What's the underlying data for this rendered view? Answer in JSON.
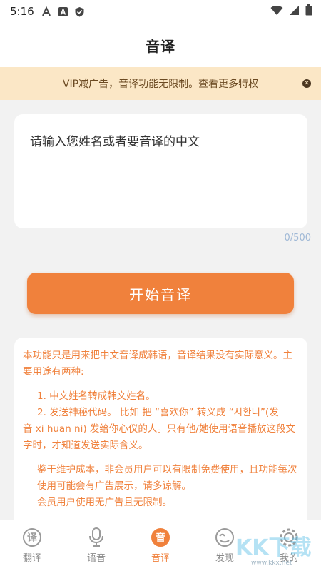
{
  "status_bar": {
    "time": "5:16",
    "left_icons": [
      "font-a-icon",
      "font-box-icon",
      "shield-check-icon"
    ],
    "right_icons": [
      "wifi-icon",
      "signal-icon",
      "battery-icon"
    ]
  },
  "header": {
    "title": "音译"
  },
  "vip_banner": {
    "text": "VIP减广告，音译功能无限制。查看更多特权",
    "close_icon": "close-icon"
  },
  "input": {
    "placeholder": "请输入您姓名或者要音译的中文",
    "value": "",
    "counter": "0/500"
  },
  "start_button": {
    "label": "开始音译"
  },
  "info": {
    "paragraph1": "本功能只是用来把中文音译成韩语，音译结果没有实际意义。主要用途有两种:",
    "item1": "1. 中文姓名转成韩文姓名。",
    "item2_line1": "2. 发送神秘代码。 比如 把 “喜欢你” 转义成 “시환니”(发",
    "item2_rest": "音 xi huan ni) 发给你心仪的人。只有他/她使用语音播放这段文字时，才知道发送实际含义。",
    "paragraph2": "鉴于维护成本，非会员用户可以有限制免费使用，且功能每次使用可能会有广告展示，请多谅解。",
    "paragraph3": "会员用户使用无广告且无限制。"
  },
  "bottom_nav": {
    "items": [
      {
        "label": "翻译",
        "glyph": "译",
        "icon": "translate-icon",
        "active": false
      },
      {
        "label": "语音",
        "glyph": "",
        "icon": "microphone-icon",
        "active": false
      },
      {
        "label": "音译",
        "glyph": "音",
        "icon": "transliterate-icon",
        "active": true
      },
      {
        "label": "发现",
        "glyph": "",
        "icon": "discover-face-icon",
        "active": false
      },
      {
        "label": "我的",
        "glyph": "",
        "icon": "profile-gear-icon",
        "active": false
      }
    ]
  },
  "watermark": {
    "brand": "KK下载",
    "url": "www.kkx.net"
  },
  "colors": {
    "accent": "#f0813c",
    "banner_bg": "#fbe7c6",
    "page_bg": "#f2f2f2"
  }
}
